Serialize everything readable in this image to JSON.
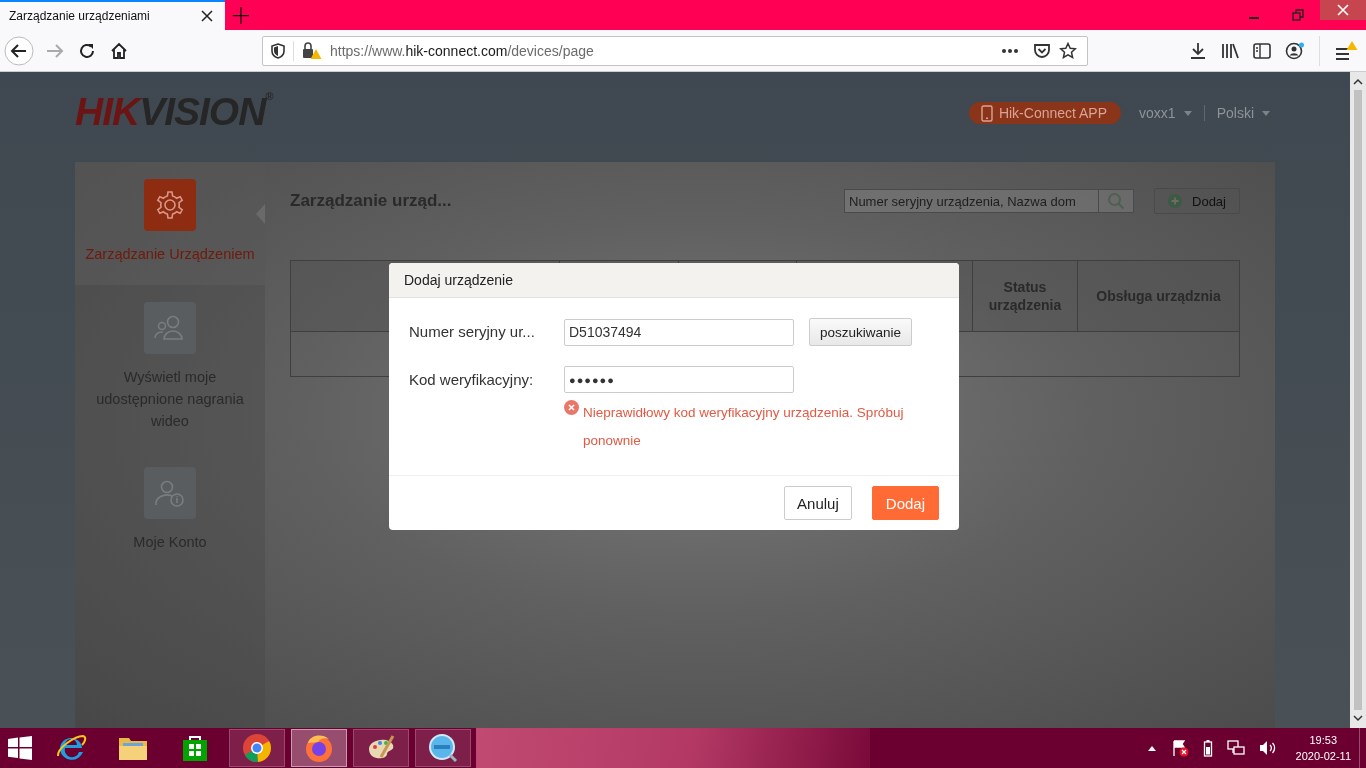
{
  "browser": {
    "tabs": [
      {
        "title": "Zarządzanie urządzeniami",
        "selected": true
      }
    ],
    "new_tab": "+",
    "address": {
      "scheme": "https://www.",
      "host": "hik-connect.com",
      "path": "/devices/page"
    }
  },
  "header": {
    "logo": [
      "HIK",
      "VISION"
    ],
    "logo_mark": "®",
    "app_button": "Hik-Connect APP",
    "user": "voxx1",
    "language": "Polski"
  },
  "sidebar": {
    "items": [
      {
        "label": "Zarządzanie Urządzeniem",
        "kind": "gear",
        "selected": true
      },
      {
        "label": "Wyświetl moje udostępnione nagrania wideo",
        "kind": "people",
        "selected": false
      },
      {
        "label": "Moje Konto",
        "kind": "account",
        "selected": false
      }
    ]
  },
  "main": {
    "title": "Zarządzanie urząd...",
    "search": {
      "placeholder": "Numer seryjny urządzenia, Nazwa dom"
    },
    "add_button": "Dodaj",
    "table": {
      "columns": [
        {
          "label": "Status urządzenia"
        },
        {
          "label": "Obsługa urządznia"
        }
      ]
    }
  },
  "dialog": {
    "title": "Dodaj urządzenie",
    "fields": [
      {
        "label": "Numer seryjny ur...",
        "value": "D51037494",
        "kind": "text"
      },
      {
        "label": "Kod weryfikacyjny:",
        "value": "●●●●●●",
        "kind": "password"
      }
    ],
    "search_button": "poszukiwanie",
    "error": "Nieprawidłowy kod weryfikacyjny urządzenia. Spróbuj ponownie",
    "buttons": [
      {
        "label": "Anuluj",
        "kind": "secondary"
      },
      {
        "label": "Dodaj",
        "kind": "primary"
      }
    ]
  },
  "taskbar": {
    "apps": [
      {
        "kind": "ie",
        "selected": false
      },
      {
        "kind": "explorer",
        "selected": false
      },
      {
        "kind": "store",
        "selected": false
      },
      {
        "kind": "chrome",
        "selected": false
      },
      {
        "kind": "firefox",
        "selected": true
      },
      {
        "kind": "paint",
        "selected": false
      },
      {
        "kind": "magnifier",
        "selected": false
      }
    ],
    "time": "19:53",
    "date": "2020-02-11"
  }
}
